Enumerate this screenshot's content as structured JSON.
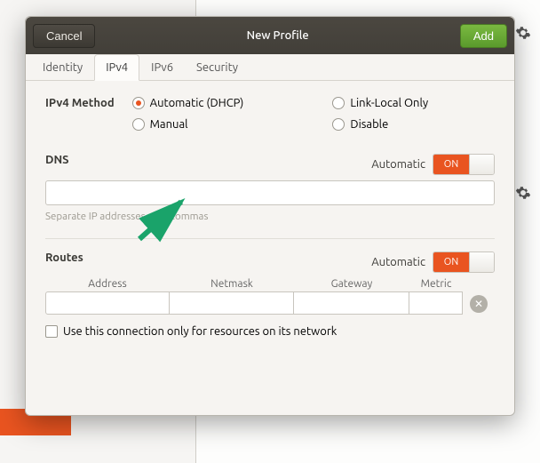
{
  "titlebar": {
    "cancel": "Cancel",
    "title": "New Profile",
    "add": "Add"
  },
  "tabs": {
    "identity": "Identity",
    "ipv4": "IPv4",
    "ipv6": "IPv6",
    "security": "Security"
  },
  "method": {
    "label": "IPv4 Method",
    "auto": "Automatic (DHCP)",
    "manual": "Manual",
    "linklocal": "Link-Local Only",
    "disable": "Disable"
  },
  "dns": {
    "label": "DNS",
    "auto_label": "Automatic",
    "toggle_on": "ON",
    "value": "",
    "hint": "Separate IP addresses with commas"
  },
  "routes": {
    "label": "Routes",
    "auto_label": "Automatic",
    "toggle_on": "ON",
    "cols": {
      "address": "Address",
      "netmask": "Netmask",
      "gateway": "Gateway",
      "metric": "Metric"
    },
    "row": {
      "address": "",
      "netmask": "",
      "gateway": "",
      "metric": ""
    },
    "only_resources": "Use this connection only for resources on its network"
  }
}
